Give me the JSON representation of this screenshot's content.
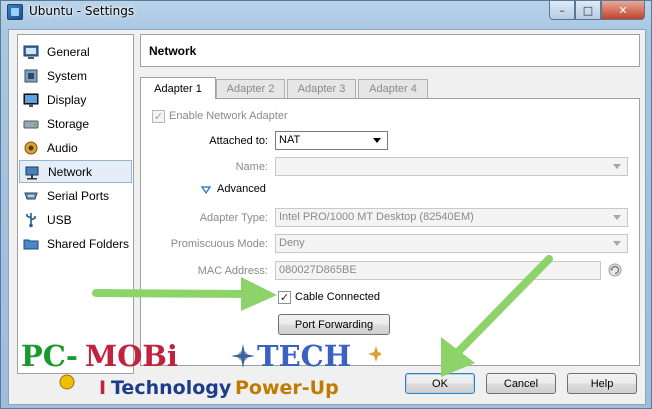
{
  "window": {
    "title": "Ubuntu - Settings",
    "controls": {
      "minimize": "–",
      "maximize": "□",
      "close": "✕"
    }
  },
  "sidebar": {
    "items": [
      {
        "label": "General",
        "icon": "general-icon"
      },
      {
        "label": "System",
        "icon": "system-icon"
      },
      {
        "label": "Display",
        "icon": "display-icon"
      },
      {
        "label": "Storage",
        "icon": "storage-icon"
      },
      {
        "label": "Audio",
        "icon": "audio-icon"
      },
      {
        "label": "Network",
        "icon": "network-icon",
        "selected": true
      },
      {
        "label": "Serial Ports",
        "icon": "serial-ports-icon"
      },
      {
        "label": "USB",
        "icon": "usb-icon"
      },
      {
        "label": "Shared Folders",
        "icon": "shared-folders-icon"
      }
    ]
  },
  "header": {
    "title": "Network"
  },
  "tabs": [
    {
      "label": "Adapter 1",
      "active": true
    },
    {
      "label": "Adapter 2"
    },
    {
      "label": "Adapter 3"
    },
    {
      "label": "Adapter 4"
    }
  ],
  "adapter": {
    "enable_label": "Enable Network Adapter",
    "enable_checked": "✓",
    "attached_label": "Attached to:",
    "attached_value": "NAT",
    "name_label": "Name:",
    "name_value": "",
    "advanced_label": "Advanced",
    "adapter_type_label": "Adapter Type:",
    "adapter_type_value": "Intel PRO/1000 MT Desktop (82540EM)",
    "promiscuous_label": "Promiscuous Mode:",
    "promiscuous_value": "Deny",
    "mac_label": "MAC Address:",
    "mac_value": "080027D865BE",
    "cable_label": "Cable Connected",
    "cable_checked": "✓",
    "port_forwarding_label": "Port Forwarding"
  },
  "buttons": {
    "ok": "OK",
    "cancel": "Cancel",
    "help": "Help"
  },
  "watermark": {
    "line1": "PC-MOBi TECH",
    "line2": "Technology Power-Up"
  },
  "colors": {
    "arrow": "#8ed36a",
    "selected_bg": "#e5eef8",
    "watermark_pc": "#1a9a2e",
    "watermark_mobi": "#c0243c",
    "watermark_tech": "#3a62c0"
  }
}
